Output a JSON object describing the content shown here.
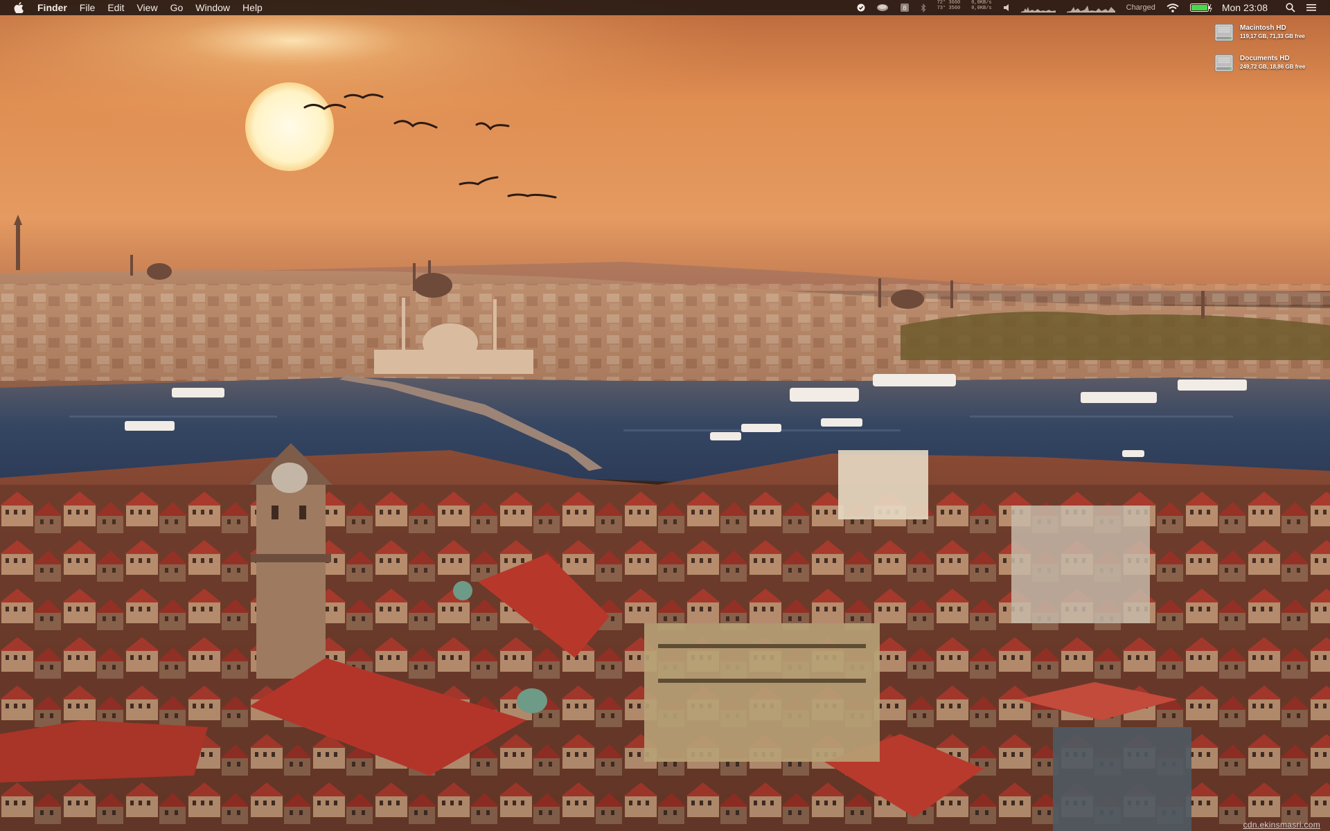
{
  "menubar": {
    "apple_icon": "apple-icon",
    "app_name": "Finder",
    "items": [
      {
        "label": "File"
      },
      {
        "label": "Edit"
      },
      {
        "label": "View"
      },
      {
        "label": "Go"
      },
      {
        "label": "Window"
      },
      {
        "label": "Help"
      }
    ],
    "status": {
      "icons": [
        "checkmark-icon",
        "drive-icon",
        "shield-icon",
        "bluetooth-icon",
        "temperature-icon",
        "network-speed-icon",
        "volume-icon",
        "cpu-graph-icon",
        "memory-graph-icon",
        "wifi-icon",
        "battery-icon",
        "search-icon",
        "list-icon"
      ],
      "temp_line1": "72° 3660",
      "temp_line2": "73° 3560",
      "net_line1": "0,0KB/s",
      "net_line2": "0,0KB/s",
      "battery_status": "Charged",
      "clock": "Mon 23:08"
    }
  },
  "desktop": {
    "drives": [
      {
        "name": "Macintosh HD",
        "info": "119,17 GB, 71,33 GB free",
        "icon": "hard-drive-icon"
      },
      {
        "name": "Documents HD",
        "info": "249,72 GB, 18,86 GB free",
        "icon": "hard-drive-icon"
      }
    ],
    "watermark": "cdn.ekinsmasri.com"
  },
  "colors": {
    "sky_top": "#c9703c",
    "sky_glow": "#f3b06a",
    "water": "#2f3e58",
    "roofs": "#a8352a",
    "battery": "#49d84a"
  }
}
